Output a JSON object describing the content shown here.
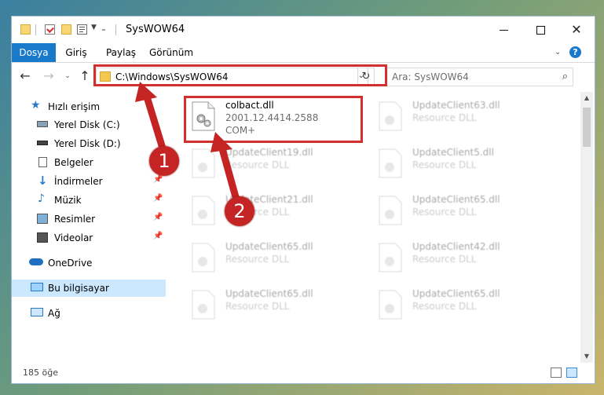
{
  "window": {
    "title": "SysWOW64",
    "controls": {
      "minimize": "minimize",
      "maximize": "maximize",
      "close": "✕"
    }
  },
  "quick_access_icons": [
    "folder-icon",
    "check-properties-icon",
    "new-folder-icon",
    "properties-icon"
  ],
  "ribbon": {
    "tabs": [
      "Dosya",
      "Giriş",
      "Paylaş",
      "Görünüm"
    ],
    "file_tab_color": "#1979ca"
  },
  "address": {
    "path": "C:\\Windows\\SysWOW64",
    "search_placeholder": "Ara: SysWOW64"
  },
  "sidebar": {
    "items": [
      {
        "label": "Hızlı erişim",
        "icon": "star-icon"
      },
      {
        "label": "Yerel Disk (C:)",
        "icon": "drive-icon"
      },
      {
        "label": "Yerel Disk (D:)",
        "icon": "drive-icon"
      },
      {
        "label": "Belgeler",
        "icon": "documents-icon"
      },
      {
        "label": "İndirmeler",
        "icon": "download-icon"
      },
      {
        "label": "Müzik",
        "icon": "music-icon"
      },
      {
        "label": "Resimler",
        "icon": "pictures-icon"
      },
      {
        "label": "Videolar",
        "icon": "videos-icon"
      },
      {
        "label": "OneDrive",
        "icon": "cloud-icon"
      },
      {
        "label": "Bu bilgisayar",
        "icon": "computer-icon"
      },
      {
        "label": "Ağ",
        "icon": "network-icon"
      }
    ]
  },
  "files": [
    {
      "name": "colbact.dll",
      "line2": "2001.12.4414.2588",
      "line3": "COM+"
    },
    {
      "name": "UpdateClient63.dll",
      "line2": "Resource DLL"
    },
    {
      "name": "UpdateClient19.dll",
      "line2": "Resource DLL"
    },
    {
      "name": "UpdateClient5.dll",
      "line2": "Resource DLL"
    },
    {
      "name": "UpdateClient21.dll",
      "line2": "Resource DLL"
    },
    {
      "name": "UpdateClient65.dll",
      "line2": "Resource DLL"
    },
    {
      "name": "UpdateClient65.dll",
      "line2": "Resource DLL"
    },
    {
      "name": "UpdateClient42.dll",
      "line2": "Resource DLL"
    },
    {
      "name": "UpdateClient65.dll",
      "line2": "Resource DLL"
    },
    {
      "name": "UpdateClient65.dll",
      "line2": "Resource DLL"
    }
  ],
  "status": {
    "item_count": "185 öğe"
  },
  "annotations": {
    "badge1": "1",
    "badge2": "2",
    "color": "#c42424"
  }
}
